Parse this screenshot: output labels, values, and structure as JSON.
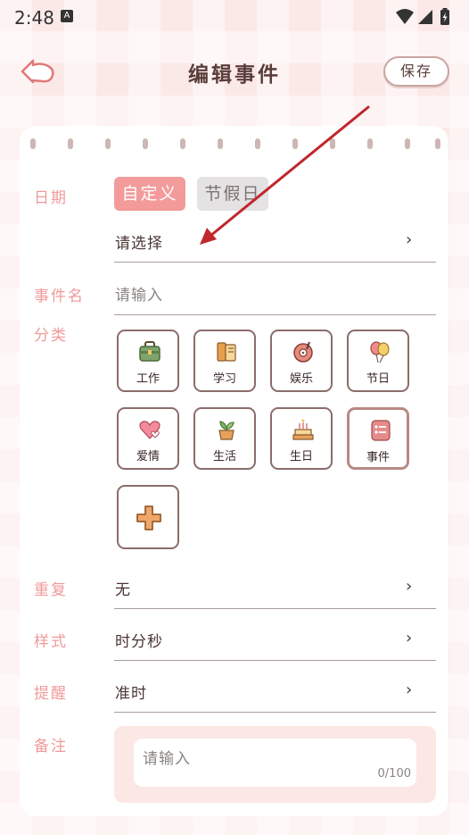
{
  "status": {
    "time": "2:48",
    "a_badge": "A"
  },
  "header": {
    "title": "编辑事件",
    "save_label": "保存"
  },
  "form": {
    "date": {
      "label": "日期",
      "options": [
        "自定义",
        "节假日"
      ],
      "selected": "自定义",
      "value": "请选择"
    },
    "name": {
      "label": "事件名",
      "placeholder": "请输入"
    },
    "category": {
      "label": "分类",
      "items": [
        {
          "label": "工作",
          "icon": "briefcase-icon"
        },
        {
          "label": "学习",
          "icon": "books-icon"
        },
        {
          "label": "娱乐",
          "icon": "record-player-icon"
        },
        {
          "label": "节日",
          "icon": "balloons-icon"
        },
        {
          "label": "爱情",
          "icon": "hearts-icon"
        },
        {
          "label": "生活",
          "icon": "plant-pot-icon"
        },
        {
          "label": "生日",
          "icon": "birthday-cake-icon"
        },
        {
          "label": "事件",
          "icon": "event-list-icon"
        }
      ],
      "selected": "事件",
      "add_icon": "plus-icon"
    },
    "repeat": {
      "label": "重复",
      "value": "无"
    },
    "style": {
      "label": "样式",
      "value": "时分秒"
    },
    "reminder": {
      "label": "提醒",
      "value": "准时"
    },
    "notes": {
      "label": "备注",
      "placeholder": "请输入",
      "counter": "0/100"
    }
  },
  "colors": {
    "accent": "#f39b9b",
    "label": "#f09a9a",
    "annotation_arrow": "#c0272d"
  }
}
